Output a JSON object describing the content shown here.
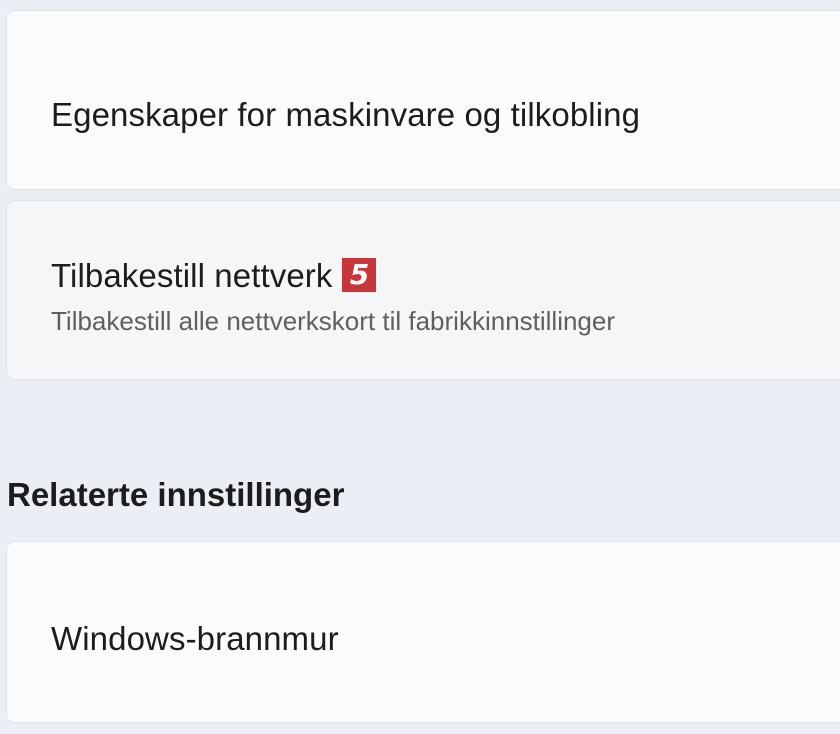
{
  "cards": {
    "hardware": {
      "title": "Egenskaper for maskinvare og tilkobling"
    },
    "reset": {
      "title": "Tilbakestill nettverk",
      "badge": "5",
      "subtitle": "Tilbakestill alle nettverkskort til fabrikkinnstillinger"
    }
  },
  "related": {
    "heading": "Relaterte innstillinger",
    "firewall": {
      "title": "Windows-brannmur"
    }
  },
  "colors": {
    "background": "#ebeff5",
    "card": "#fafbfd",
    "badge": "#c9363a"
  }
}
